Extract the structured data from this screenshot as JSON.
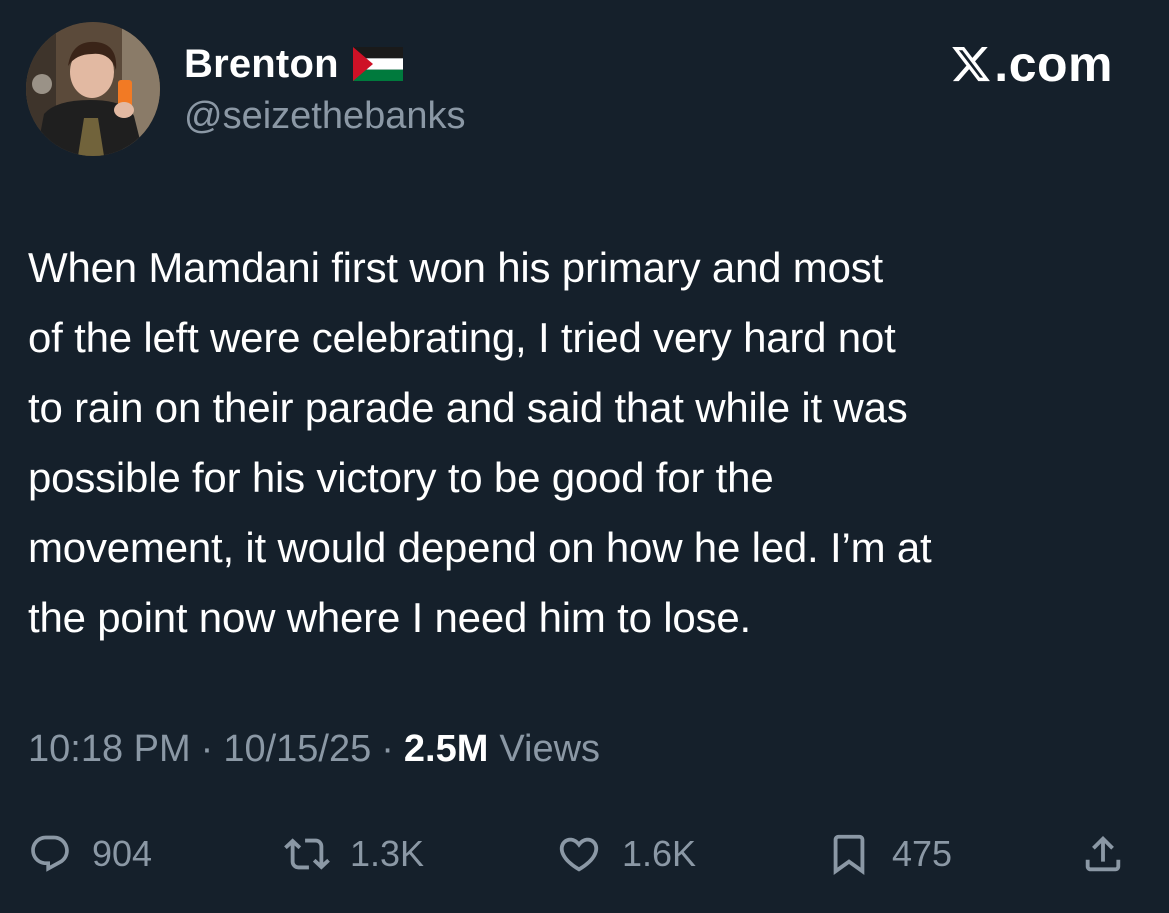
{
  "author": {
    "display_name": "Brenton",
    "handle": "@seizethebanks",
    "flag_icon": "palestine-flag-icon",
    "avatar_icon": "profile-photo"
  },
  "brand": {
    "label": ".com",
    "icon": "x-logo-icon"
  },
  "tweet": {
    "text": "When Mamdani first won his primary and most\nof the left were celebrating, I tried very hard not\nto rain on their parade and said that while it was\npossible for his victory to be good for the\nmovement, it would depend on how he led. I’m at\nthe point now where I need him to lose."
  },
  "meta": {
    "time": "10:18 PM",
    "separator": "·",
    "date": "10/15/25",
    "views_count": "2.5M",
    "views_label": "Views"
  },
  "actions": {
    "replies": {
      "count": "904",
      "icon": "reply-icon"
    },
    "reposts": {
      "count": "1.3K",
      "icon": "repost-icon"
    },
    "likes": {
      "count": "1.6K",
      "icon": "heart-icon"
    },
    "bookmarks": {
      "count": "475",
      "icon": "bookmark-icon"
    },
    "share": {
      "icon": "share-icon"
    }
  },
  "colors": {
    "background": "#15202b",
    "primary_text": "#ffffff",
    "secondary_text": "#8b98a5",
    "flag_red": "#ce1126",
    "flag_green": "#007a3d"
  }
}
